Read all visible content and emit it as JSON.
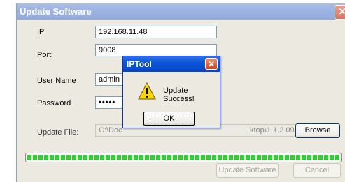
{
  "window": {
    "title": "Update Software",
    "close_glyph": "✕"
  },
  "form": {
    "ip_label": "IP",
    "ip_value": "192.168.11.48",
    "port_label": "Port",
    "port_value": "9008",
    "username_label": "User Name",
    "username_value": "admin",
    "password_label": "Password",
    "password_value": "•••••",
    "update_file_label": "Update File:",
    "update_file_value_left": "C:\\Doc",
    "update_file_value_right": "ktop\\1.1.2.090801\\T",
    "browse_label": "Browse"
  },
  "progress": {
    "percent": 100
  },
  "actions": {
    "update_label": "Update Software",
    "cancel_label": "Cancel"
  },
  "dialog": {
    "title": "IPTool",
    "close_glyph": "✕",
    "icon": "warning-icon",
    "message": "Update Success!",
    "ok_label": "OK"
  },
  "colors": {
    "title_bar": "#9db3e1",
    "dialog_title_bar": "#0b55d8",
    "progress_green": "#2fcf2f",
    "close_red": "#d77560"
  }
}
